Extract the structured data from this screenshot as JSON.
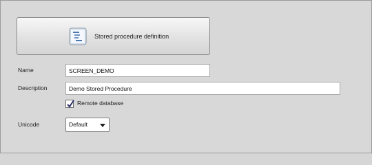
{
  "header": {
    "title": "Stored procedure definition",
    "icon": "procedure-definition-icon"
  },
  "form": {
    "name_label": "Name",
    "name_value": "SCREEN_DEMO",
    "description_label": "Description",
    "description_value": "Demo Stored Procedure",
    "remote_label": "Remote database",
    "remote_checked": true,
    "unicode_label": "Unicode",
    "unicode_value": "Default"
  }
}
